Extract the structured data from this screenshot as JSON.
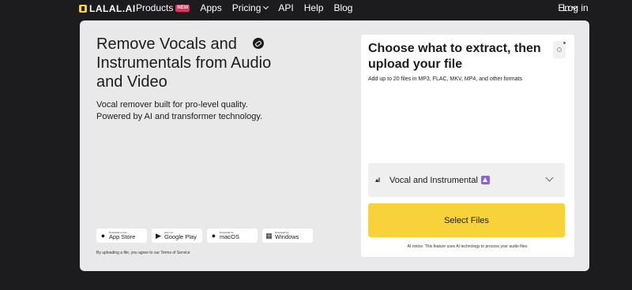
{
  "nav": {
    "logo_text": "LALAL.AI",
    "products_label": "Products",
    "new_badge": "NEW",
    "apps_label": "Apps",
    "pricing_label": "Pricing",
    "api_label": "API",
    "help_label": "Help",
    "blog_label": "Blog",
    "language": "En",
    "login_label": "Log in"
  },
  "hero": {
    "title": "Remove Vocals and Instrumentals from Audio and Video",
    "subtitle": "Vocal remover built for pro-level quality. Powered by AI and transformer technology."
  },
  "stores": [
    {
      "small": "Download on the",
      "big": "App Store",
      "icon": "apple-icon"
    },
    {
      "small": "Get it on",
      "big": "Google Play",
      "icon": "google-play-icon"
    },
    {
      "small": "Download for",
      "big": "macOS",
      "icon": "macos-icon"
    },
    {
      "small": "Download for",
      "big": "Windows",
      "icon": "windows-icon"
    }
  ],
  "terms_text": "By uploading a file, you agree to our Terms of Service",
  "panel": {
    "title": "Choose what to extract, then upload your file",
    "subtitle": "Add up to 20 files in MP3, FLAC, MKV, MP4, and other formats",
    "selector_label": "Vocal and Instrumental",
    "select_files_label": "Select Files",
    "ai_notice": "AI notice: This feature uses AI technology to process your audio files."
  },
  "colors": {
    "accent_yellow": "#f7d23a",
    "badge_red": "#e1305a",
    "ai_purple": "#8b5cf6",
    "background": "#1c1b1d"
  }
}
